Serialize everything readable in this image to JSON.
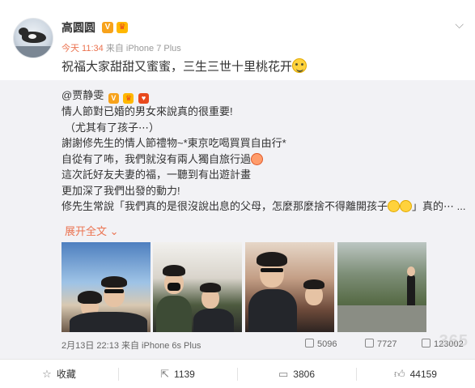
{
  "post": {
    "username": "高圆圆",
    "time": "今天 11:34",
    "source": "来自 iPhone 7 Plus",
    "text": "祝福大家甜甜又蜜蜜，三生三世十里桃花开",
    "emoji": "grin-emoji"
  },
  "repost": {
    "author": "@贾静雯",
    "lines": [
      "情人節對已婚的男女來說真的很重要!",
      "（尤其有了孩子⋯）",
      "謝謝修先生的情人節禮物~*東京吃喝買買自由行*",
      "自從有了咘，我們就沒有兩人獨自旅行過",
      "這次託好友夫妻的福，一聽到有出遊計畫",
      "更加深了我們出發的動力!",
      "修先生常說「我們真的是很沒說出息的父母，怎麼那麼捨不得離開孩子",
      "」真的⋯ ..."
    ],
    "expand_label": "展开全文",
    "date": "2月13日 22:13",
    "source": "来自 iPhone 6s Plus",
    "reposts": "5096",
    "comments": "7727",
    "likes": "123002"
  },
  "watermark": "365",
  "footer": {
    "favorite_label": "收藏",
    "repost_count": "1139",
    "comment_count": "3806",
    "like_count": "44159"
  },
  "colors": {
    "accent": "#eb7350",
    "repost_bg": "#f2f2f5",
    "vip_badge": "#f7a21b"
  }
}
